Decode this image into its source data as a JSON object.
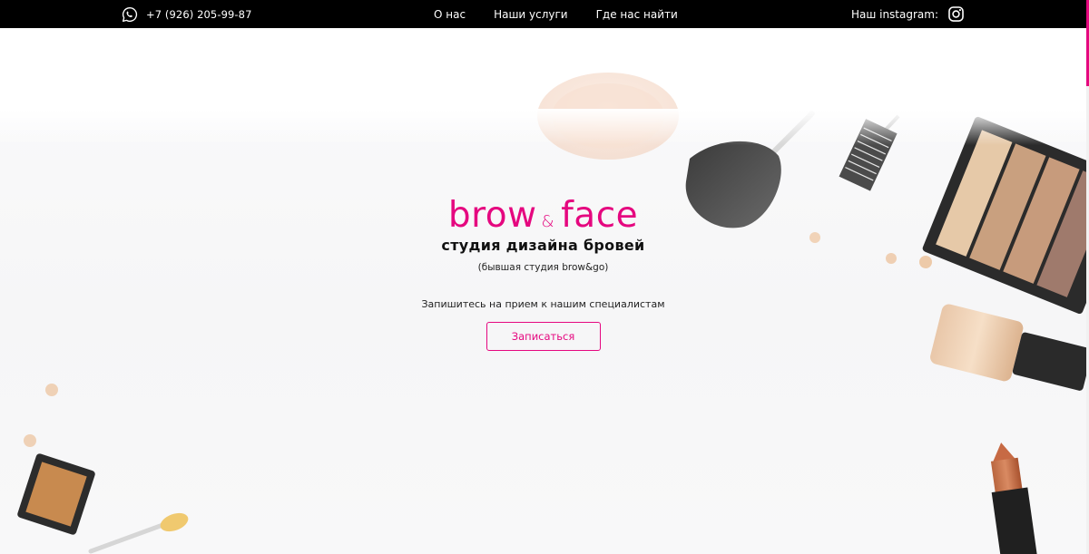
{
  "header": {
    "phone": "+7 (926) 205-99-87",
    "nav": [
      "О нас",
      "Наши услуги",
      "Где нас найти"
    ],
    "instagram_label": "Наш instagram:"
  },
  "hero": {
    "logo_word1": "brow",
    "logo_amp": "&",
    "logo_word2": "face",
    "subtitle": "студия дизайна бровей",
    "former_name": "(бывшая студия brow&go)",
    "invite": "Запишитесь на прием к нашим специалистам",
    "cta_label": "Записаться"
  },
  "colors": {
    "accent": "#e5077f",
    "topbar": "#000000",
    "text": "#111111"
  },
  "icons": [
    "whatsapp-icon",
    "instagram-icon"
  ]
}
